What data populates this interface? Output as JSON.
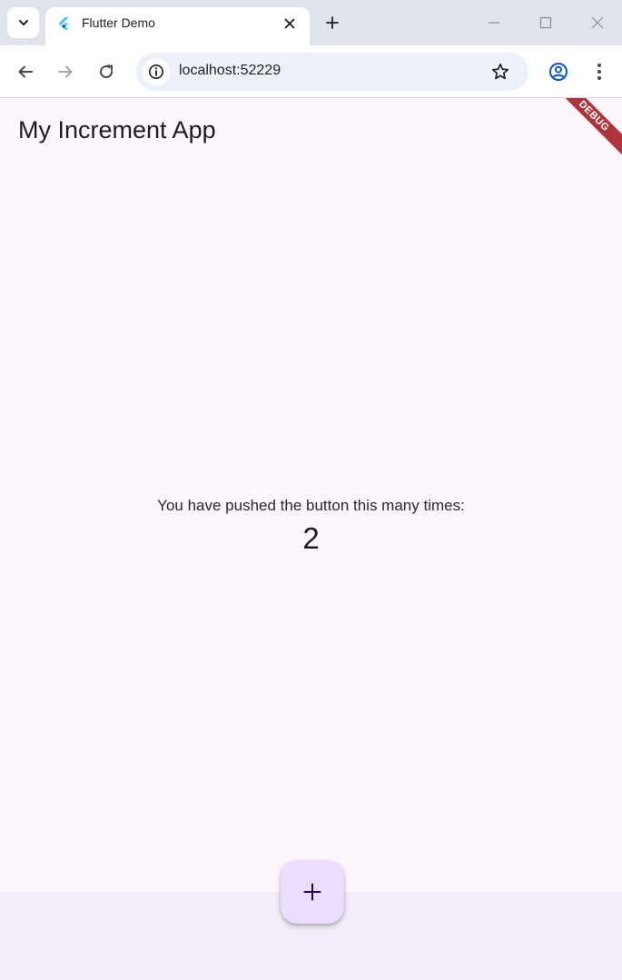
{
  "browser": {
    "tab": {
      "title": "Flutter Demo"
    },
    "address_bar": {
      "url": "localhost:52229"
    }
  },
  "app": {
    "title": "My Increment App",
    "counter_caption": "You have pushed the button this many times:",
    "counter_value": "2",
    "debug_banner": "DEBUG"
  },
  "icons": {
    "tab_search": "chevron-down-icon",
    "favicon": "flutter-logo-icon",
    "close": "close-icon",
    "new_tab": "plus-icon",
    "back": "arrow-left-icon",
    "forward": "arrow-right-icon",
    "reload": "reload-icon",
    "site_info": "info-icon",
    "bookmark": "star-icon",
    "profile": "account-circle-icon",
    "menu": "more-vert-icon",
    "fab": "add-icon"
  },
  "colors": {
    "app_background": "#fdf7fd",
    "fab_background": "#eaddff",
    "debug_banner": "#b0343c",
    "bottom_area": "#f3edf7"
  }
}
